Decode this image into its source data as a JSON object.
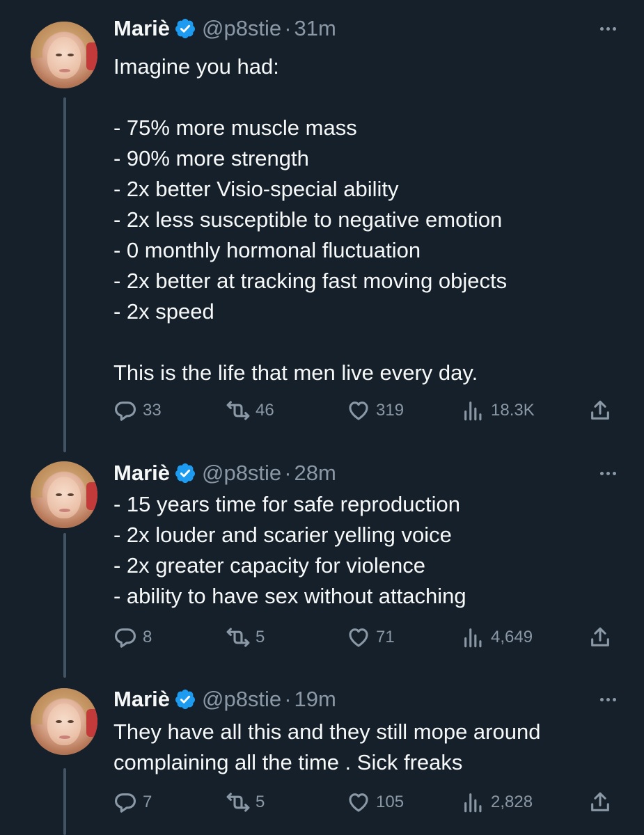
{
  "author": {
    "name": "Mariè",
    "handle": "@p8stie",
    "separator": "·"
  },
  "tweets": [
    {
      "time": "31m",
      "text": "Imagine you had:\n\n- 75% more muscle mass\n- 90% more strength\n- 2x better Visio-special ability\n- 2x less susceptible to negative emotion\n- 0 monthly hormonal fluctuation\n- 2x better at tracking fast moving objects\n- 2x speed\n\nThis is the life that men live every day.",
      "replies": "33",
      "reposts": "46",
      "likes": "319",
      "views": "18.3K"
    },
    {
      "time": "28m",
      "text": "- 15 years time for safe reproduction\n- 2x louder and scarier yelling voice\n- 2x greater capacity for violence\n- ability to have sex without attaching",
      "replies": "8",
      "reposts": "5",
      "likes": "71",
      "views": "4,649"
    },
    {
      "time": "19m",
      "text": "They have all this and they still mope around complaining all the time . Sick freaks",
      "replies": "7",
      "reposts": "5",
      "likes": "105",
      "views": "2,828"
    }
  ],
  "icons": {
    "verified": "verified-badge-icon",
    "more": "more-options-icon",
    "reply": "reply-icon",
    "repost": "repost-icon",
    "like": "like-icon",
    "views": "views-icon",
    "share": "share-icon"
  },
  "colors": {
    "background": "#15202b",
    "text": "#f7f9f9",
    "secondary_text": "#8b98a5",
    "verified_blue": "#1d9bf0",
    "thread_line": "#425364"
  }
}
